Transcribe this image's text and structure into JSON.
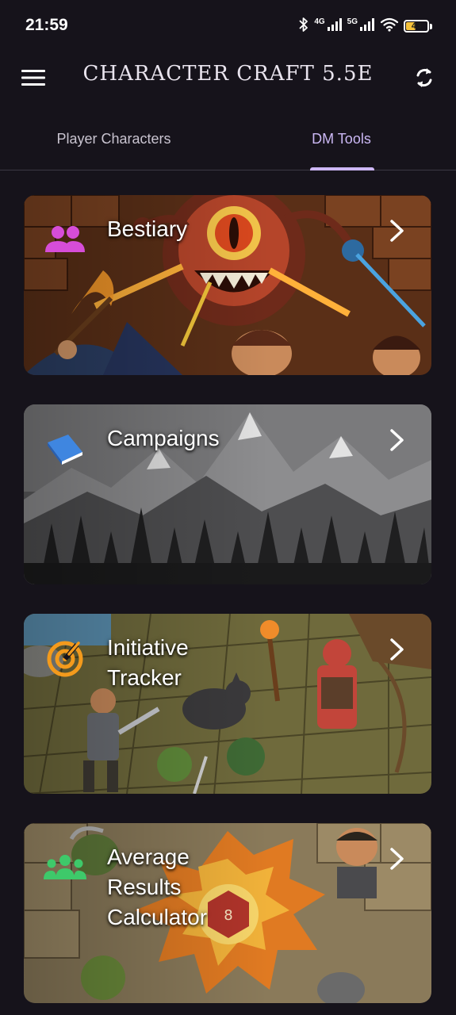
{
  "status_bar": {
    "time": "21:59",
    "network_1": "4G",
    "network_2": "5G",
    "battery_level": "43"
  },
  "app_bar": {
    "title": "CHARACTER CRAFT 5.5E",
    "menu_icon": "hamburger-menu-icon",
    "sync_icon": "sync-icon"
  },
  "tabs": [
    {
      "label": "Player Characters",
      "selected": false
    },
    {
      "label": "DM Tools",
      "selected": true
    }
  ],
  "cards": [
    {
      "title": "Bestiary",
      "icon": "group-icon",
      "icon_color": "#d64dd8"
    },
    {
      "title": "Campaigns",
      "icon": "book-icon",
      "icon_color": "#3f86e0"
    },
    {
      "title": "Initiative\nTracker",
      "icon": "target-icon",
      "icon_color": "#f39a1c"
    },
    {
      "title": "Average\nResults\nCalculator",
      "icon": "team-icon",
      "icon_color": "#3ec96a"
    }
  ],
  "colors": {
    "background": "#16131b",
    "accent": "#cdb7f6",
    "tab_inactive": "#c9c4d0"
  }
}
